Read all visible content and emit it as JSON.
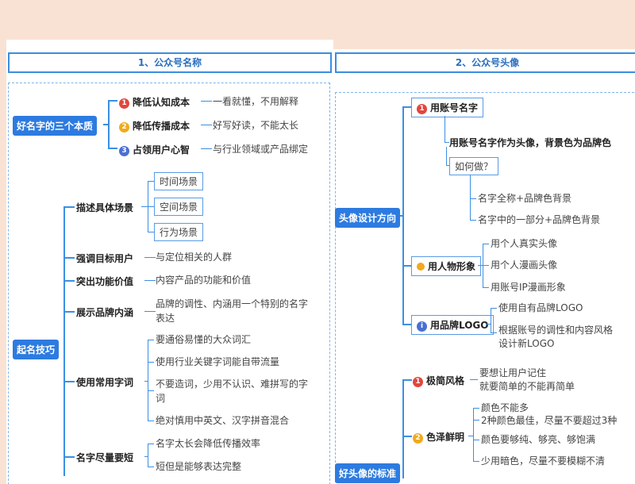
{
  "panel1": {
    "header": "1、公众号名称",
    "essence": {
      "label": "好名字的三个本质",
      "items": [
        {
          "num": "1",
          "title": "降低认知成本",
          "desc": "一看就懂，不用解释"
        },
        {
          "num": "2",
          "title": "降低传播成本",
          "desc": "好写好读，不能太长"
        },
        {
          "num": "3",
          "title": "占领用户心智",
          "desc": "与行业领域或产品绑定"
        }
      ]
    },
    "tips": {
      "label": "起名技巧",
      "scene": {
        "title": "描述具体场景",
        "items": [
          "时间场景",
          "空间场景",
          "行为场景"
        ]
      },
      "target": {
        "title": "强调目标用户",
        "desc": "与定位相关的人群"
      },
      "function": {
        "title": "突出功能价值",
        "desc": "内容产品的功能和价值"
      },
      "brand": {
        "title": "展示品牌内涵",
        "desc1": "品牌的调性、内涵用一个特别的名字",
        "desc2": "表达"
      },
      "words": {
        "title": "使用常用字词",
        "items": [
          "要通俗易懂的大众词汇",
          "使用行业关键字词能自带流量",
          "不要造词，少用不认识、难拼写的字",
          "词",
          "绝对慎用中英文、汉字拼音混合"
        ]
      },
      "short": {
        "title": "名字尽量要短",
        "items": [
          "名字太长会降低传播效率",
          "短但是能够表达完整"
        ]
      }
    }
  },
  "panel2": {
    "header": "2、公众号头像",
    "direction": {
      "label": "头像设计方向",
      "account": {
        "title": "用账号名字",
        "desc": "用账号名字作为头像，背景色为品牌色",
        "how": "如何做？",
        "items": [
          "名字全称+品牌色背景",
          "名字中的一部分+品牌色背景"
        ]
      },
      "person": {
        "title": "用人物形象",
        "items": [
          "用个人真实头像",
          "用个人漫画头像",
          "用账号IP漫画形象"
        ]
      },
      "logo": {
        "title": "用品牌LOGO",
        "items": [
          "使用自有品牌LOGO",
          "根据账号的调性和内容风格",
          "设计新LOGO"
        ]
      }
    },
    "standard": {
      "label": "好头像的标准",
      "simple": {
        "num": "1",
        "title": "极简风格",
        "desc1": "要想让用户记住",
        "desc2": "就要简单的不能再简单"
      },
      "color": {
        "num": "2",
        "title": "色泽鲜明",
        "items": [
          "颜色不能多",
          "2种颜色最佳，尽量不要超过3种",
          "颜色要够纯、够亮、够饱满",
          "少用暗色，尽量不要模糊不清"
        ]
      }
    }
  }
}
